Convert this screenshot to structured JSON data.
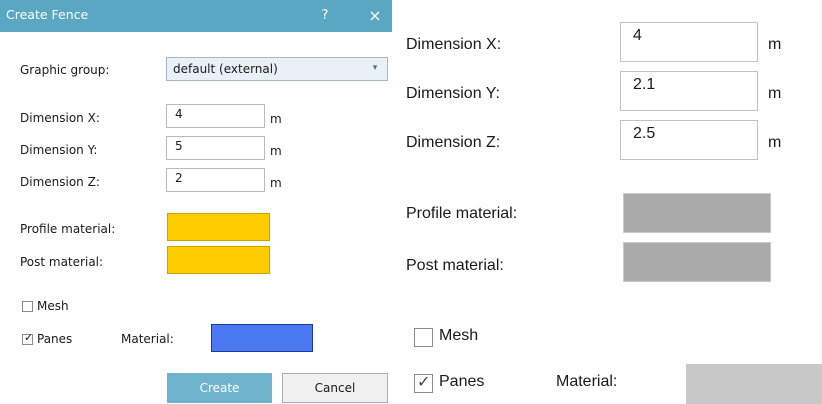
{
  "dialog": {
    "title": "Create Fence",
    "help_glyph": "?",
    "close_glyph": "×",
    "graphic_group": {
      "label": "Graphic group:",
      "value": "default (external)",
      "arrow_glyph": "▾"
    },
    "dim_x": {
      "label": "Dimension X:",
      "value": "4",
      "unit": "m"
    },
    "dim_y": {
      "label": "Dimension Y:",
      "value": "5",
      "unit": "m"
    },
    "dim_z": {
      "label": "Dimension Z:",
      "value": "2",
      "unit": "m"
    },
    "profile_material": {
      "label": "Profile material:",
      "color": "#ffcc00"
    },
    "post_material": {
      "label": "Post material:",
      "color": "#ffcc00"
    },
    "mesh": {
      "label": "Mesh",
      "checked": false
    },
    "panes": {
      "label": "Panes",
      "checked": true,
      "check_glyph": "✓"
    },
    "pane_material": {
      "label": "Material:",
      "color": "#4a78f0"
    },
    "create_label": "Create",
    "cancel_label": "Cancel"
  },
  "zoom": {
    "dim_x": {
      "label": "Dimension X:",
      "value": "4",
      "unit": "m"
    },
    "dim_y": {
      "label": "Dimension Y:",
      "value": "2.1",
      "unit": "m"
    },
    "dim_z": {
      "label": "Dimension Z:",
      "value": "2.5",
      "unit": "m"
    },
    "profile_material": {
      "label": "Profile material:",
      "color": "#aaaaaa"
    },
    "post_material": {
      "label": "Post material:",
      "color": "#aaaaaa"
    },
    "mesh": {
      "label": "Mesh",
      "checked": false
    },
    "panes": {
      "label": "Panes",
      "checked": true,
      "check_glyph": "✓"
    },
    "pane_material": {
      "label": "Material:",
      "color": "#c8c8c8"
    }
  },
  "colors": {
    "titlebar": "#5aa7c4",
    "create_button_bg": "#6fb3cc",
    "cancel_button_bg": "#f0f0f0"
  }
}
